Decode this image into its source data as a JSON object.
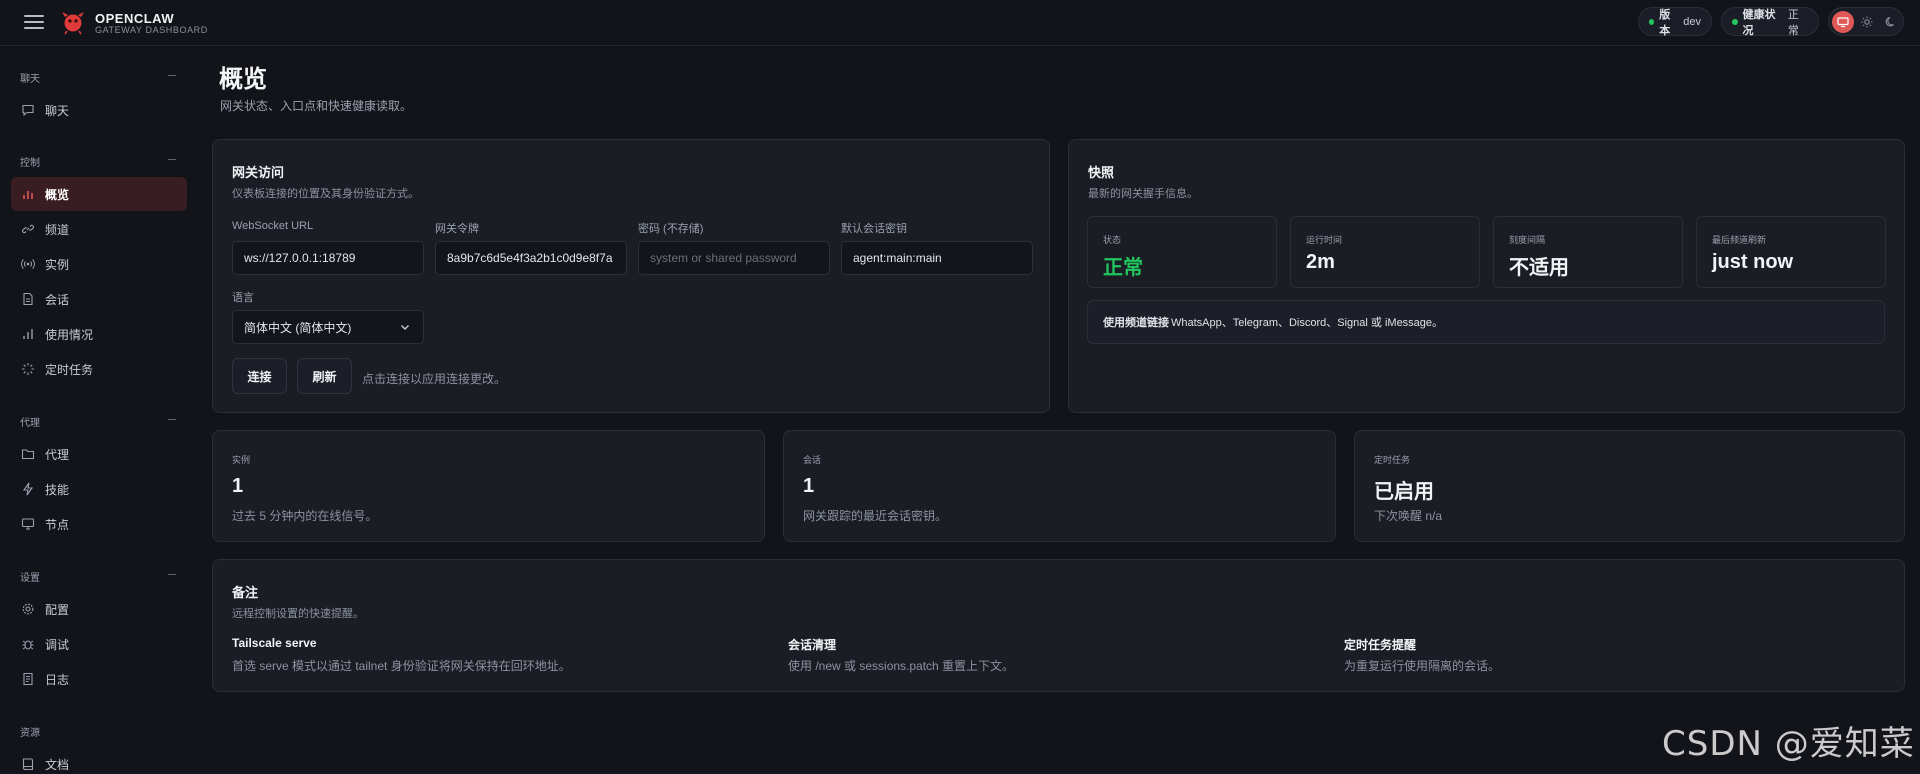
{
  "brand": {
    "name": "OPENCLAW",
    "subtitle": "GATEWAY DASHBOARD"
  },
  "header": {
    "version_label": "版本",
    "version_value": "dev",
    "health_label": "健康状况",
    "health_value": "正常",
    "status_color": "#22c55e",
    "theme_options": [
      "monitor-icon",
      "sun-icon",
      "moon-icon"
    ]
  },
  "sidebar": {
    "groups": [
      {
        "title": "聊天",
        "items": [
          {
            "label": "聊天",
            "icon": "chat-icon"
          }
        ]
      },
      {
        "title": "控制",
        "items": [
          {
            "label": "概览",
            "icon": "bar-chart-icon",
            "active": true
          },
          {
            "label": "频道",
            "icon": "link-icon"
          },
          {
            "label": "实例",
            "icon": "broadcast-icon"
          },
          {
            "label": "会话",
            "icon": "document-icon"
          },
          {
            "label": "使用情况",
            "icon": "usage-chart-icon"
          },
          {
            "label": "定时任务",
            "icon": "loader-icon"
          }
        ]
      },
      {
        "title": "代理",
        "items": [
          {
            "label": "代理",
            "icon": "folder-icon"
          },
          {
            "label": "技能",
            "icon": "bolt-icon"
          },
          {
            "label": "节点",
            "icon": "monitor-icon"
          }
        ]
      },
      {
        "title": "设置",
        "items": [
          {
            "label": "配置",
            "icon": "gear-icon"
          },
          {
            "label": "调试",
            "icon": "bug-icon"
          },
          {
            "label": "日志",
            "icon": "log-icon"
          }
        ]
      },
      {
        "title": "资源",
        "items": [
          {
            "label": "文档",
            "icon": "book-icon"
          }
        ]
      }
    ]
  },
  "page": {
    "title": "概览",
    "subtitle": "网关状态、入口点和快速健康读取。"
  },
  "gateway_access": {
    "title": "网关访问",
    "subtitle": "仪表板连接的位置及其身份验证方式。",
    "ws_url_label": "WebSocket URL",
    "ws_url_value": "ws://127.0.0.1:18789",
    "token_label": "网关令牌",
    "token_value": "8a9b7c6d5e4f3a2b1c0d9e8f7a",
    "password_label": "密码 (不存储)",
    "password_placeholder": "system or shared password",
    "session_key_label": "默认会话密钥",
    "session_key_value": "agent:main:main",
    "language_label": "语言",
    "language_value": "简体中文 (简体中文)",
    "connect_label": "连接",
    "refresh_label": "刷新",
    "hint": "点击连接以应用连接更改。"
  },
  "snapshot": {
    "title": "快照",
    "subtitle": "最新的网关握手信息。",
    "stats": [
      {
        "label": "状态",
        "value": "正常"
      },
      {
        "label": "运行时间",
        "value": "2m"
      },
      {
        "label": "刻度间隔",
        "value": "不适用"
      },
      {
        "label": "最后频道刷新",
        "value": "just now"
      }
    ],
    "callout_bold": "使用频道链接",
    "callout_text": "WhatsApp、Telegram、Discord、Signal 或 iMessage。"
  },
  "metrics": [
    {
      "label": "实例",
      "value": "1",
      "sub": "过去 5 分钟内的在线信号。"
    },
    {
      "label": "会话",
      "value": "1",
      "sub": "网关跟踪的最近会话密钥。"
    },
    {
      "label": "定时任务",
      "value": "已启用",
      "sub": "下次唤醒 n/a"
    }
  ],
  "notes": {
    "title": "备注",
    "subtitle": "远程控制设置的快速提醒。",
    "items": [
      {
        "title": "Tailscale serve",
        "text": "首选 serve 模式以通过 tailnet 身份验证将网关保持在回环地址。"
      },
      {
        "title": "会话清理",
        "text": "使用 /new 或 sessions.patch 重置上下文。"
      },
      {
        "title": "定时任务提醒",
        "text": "为重复运行使用隔离的会话。"
      }
    ]
  },
  "watermark": "CSDN @爱知菜",
  "colors": {
    "accent": "#e05858",
    "ok": "#22c55e",
    "background": "#12141a",
    "card": "#1a1d24"
  }
}
